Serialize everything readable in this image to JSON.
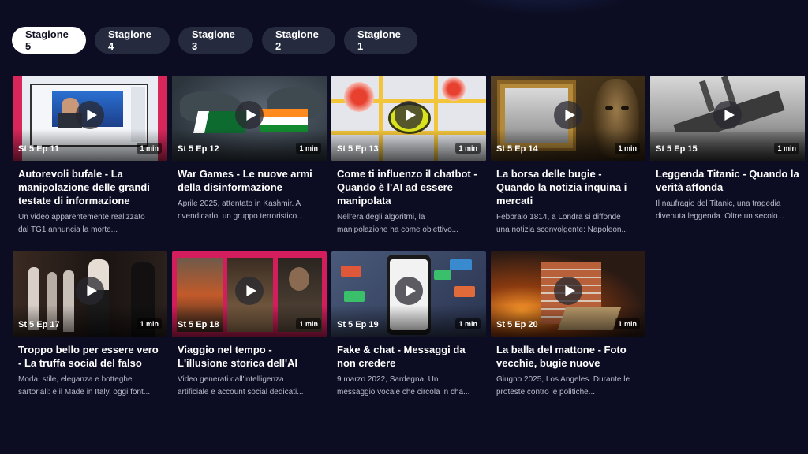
{
  "tabs": [
    {
      "label": "Stagione 5",
      "active": true
    },
    {
      "label": "Stagione 4",
      "active": false
    },
    {
      "label": "Stagione 3",
      "active": false
    },
    {
      "label": "Stagione 2",
      "active": false
    },
    {
      "label": "Stagione 1",
      "active": false
    }
  ],
  "episodes": [
    {
      "ep": "St 5 Ep 11",
      "duration": "1 min",
      "title": "Autorevoli bufale - La manipolazione delle grandi testate di informazione",
      "desc1": "Un video apparentemente realizzato",
      "desc2": "dal TG1 annuncia la morte..."
    },
    {
      "ep": "St 5 Ep 12",
      "duration": "1 min",
      "title": "War Games - Le nuove armi della disinformazione",
      "desc1": "Aprile 2025, attentato in Kashmir. A",
      "desc2": "rivendicarlo, un gruppo terroristico..."
    },
    {
      "ep": "St 5 Ep 13",
      "duration": "1 min",
      "title": "Come ti influenzo il chatbot - Quando è l'AI ad essere manipolata",
      "desc1": "Nell'era degli algoritmi, la",
      "desc2": "manipolazione ha come obiettivo..."
    },
    {
      "ep": "St 5 Ep 14",
      "duration": "1 min",
      "title": "La borsa delle bugie - Quando la notizia inquina i mercati",
      "desc1": "Febbraio 1814, a Londra si diffonde",
      "desc2": "una notizia sconvolgente: Napoleon..."
    },
    {
      "ep": "St 5 Ep 15",
      "duration": "1 min",
      "title": "Leggenda Titanic - Quando la verità affonda",
      "desc1": "Il naufragio del Titanic, una tragedia",
      "desc2": "divenuta leggenda. Oltre un secolo..."
    },
    {
      "ep": "St 5 Ep 17",
      "duration": "1 min",
      "title": "Troppo bello per essere vero - La truffa social del falso",
      "desc1": "Moda, stile, eleganza e botteghe",
      "desc2": "sartoriali: è il Made in Italy, oggi font..."
    },
    {
      "ep": "St 5 Ep 18",
      "duration": "1 min",
      "title": "Viaggio nel tempo - L'illusione storica dell'AI",
      "desc1": "Video generati dall'intelligenza",
      "desc2": "artificiale e account social dedicati..."
    },
    {
      "ep": "St 5 Ep 19",
      "duration": "1 min",
      "title": "Fake & chat - Messaggi da non credere",
      "desc1": "9 marzo 2022, Sardegna. Un",
      "desc2": "messaggio vocale che circola in cha..."
    },
    {
      "ep": "St 5 Ep 20",
      "duration": "1 min",
      "title": "La balla del mattone - Foto vecchie, bugie nuove",
      "desc1": "Giugno 2025, Los Angeles. Durante le",
      "desc2": "proteste contro le politiche..."
    }
  ],
  "thumb_icons": [
    "news-studio-image",
    "map-flags-image",
    "chatbot-targets-image",
    "painting-mask-image",
    "titanic-image",
    "fashion-runway-image",
    "historical-ai-image",
    "phone-chat-image",
    "bricks-fire-image"
  ]
}
